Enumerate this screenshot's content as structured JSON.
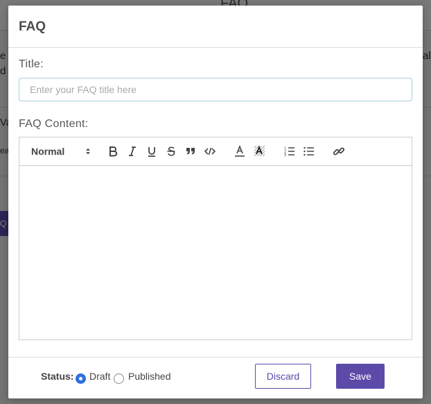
{
  "background": {
    "page_title": "FAQ",
    "left_fragments": [
      "e",
      "d",
      "Va",
      "ea",
      "Q"
    ],
    "right_fragment": "als"
  },
  "modal": {
    "title": "FAQ",
    "title_field": {
      "label": "Title:",
      "placeholder": "Enter your FAQ title here",
      "value": ""
    },
    "content_field": {
      "label": "FAQ Content:",
      "format_select": "Normal",
      "toolbar_icons": [
        "bold-icon",
        "italic-icon",
        "underline-icon",
        "strikethrough-icon",
        "blockquote-icon",
        "code-icon",
        "text-color-icon",
        "background-color-icon",
        "ordered-list-icon",
        "bullet-list-icon",
        "link-icon"
      ]
    },
    "footer": {
      "status_label": "Status:",
      "options": [
        "Draft",
        "Published"
      ],
      "selected_status": "Draft",
      "discard_label": "Discard",
      "save_label": "Save"
    }
  },
  "colors": {
    "accent": "#5c4aa9",
    "radio_checked": "#2f6fdf",
    "input_border": "#a9cfd9"
  }
}
